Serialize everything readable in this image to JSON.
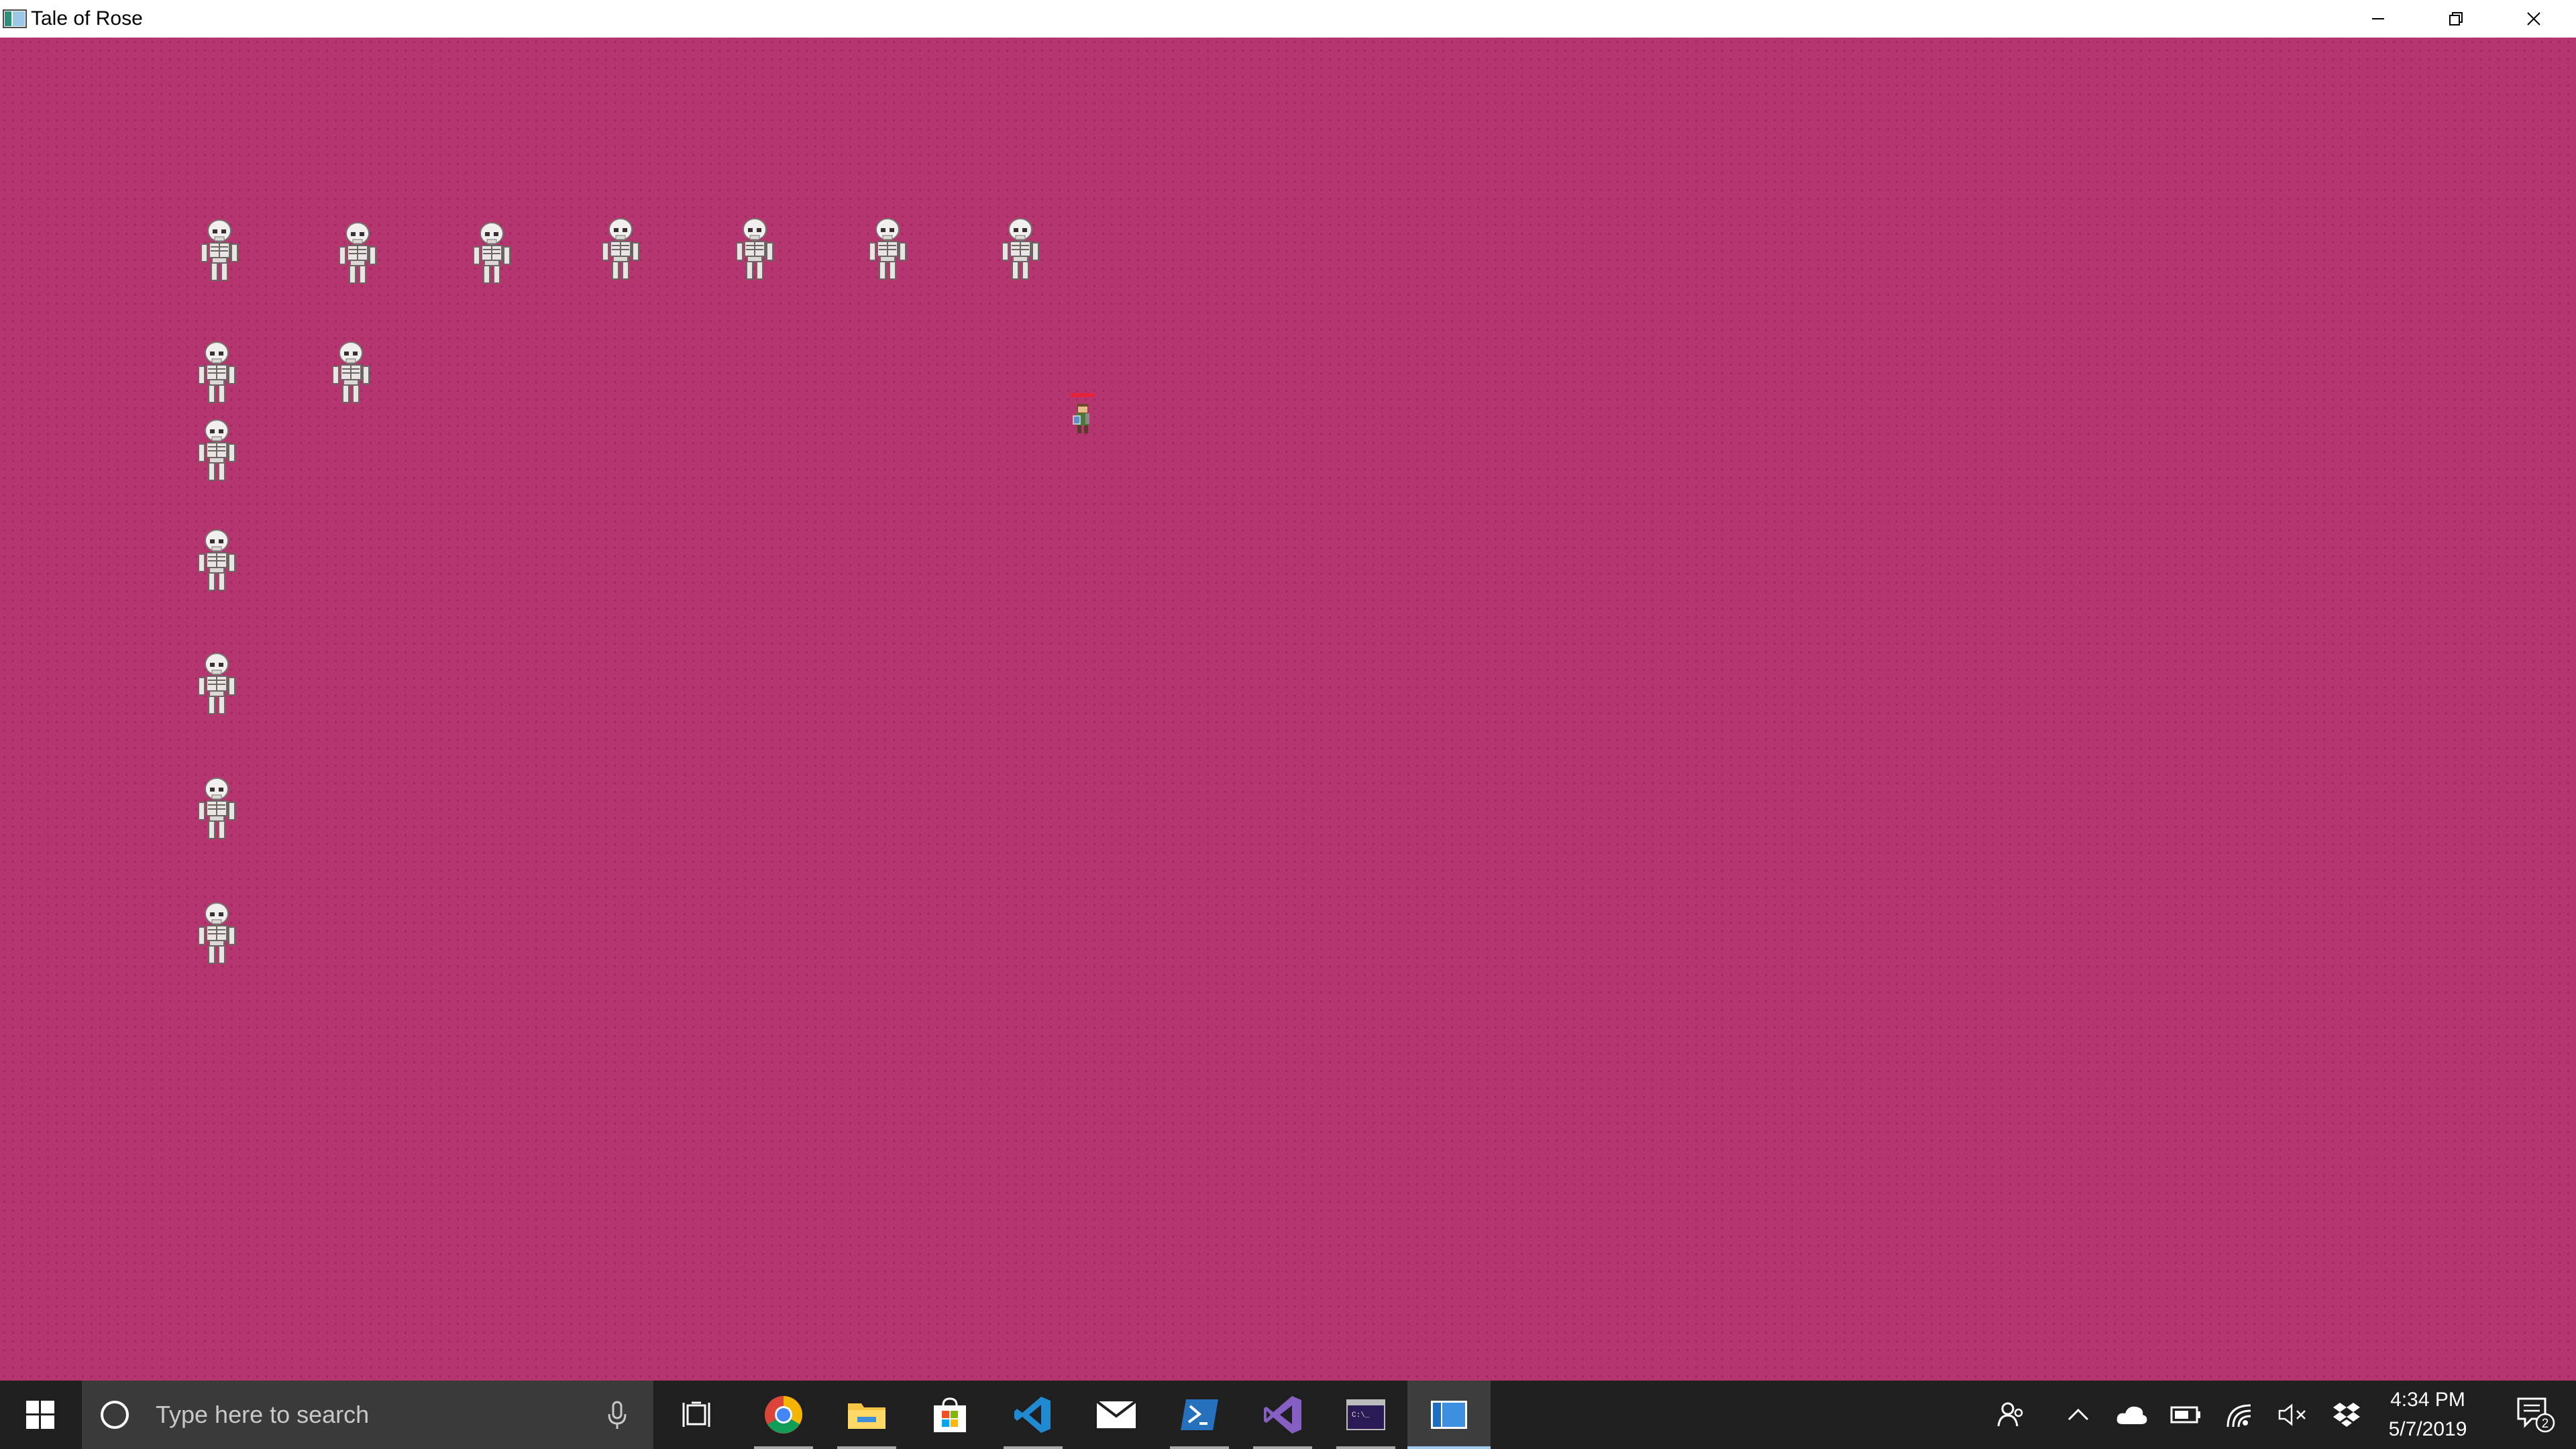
{
  "window": {
    "title": "Tale of Rose",
    "minimize_icon": "minimize-icon",
    "restore_icon": "restore-icon",
    "close_icon": "close-icon"
  },
  "game": {
    "background_color": "#b5356f",
    "enemy_type": "skeleton",
    "enemy_count": 15,
    "player_type": "hero-with-health-bar",
    "health_bar_color": "#e8213a"
  },
  "taskbar": {
    "search_placeholder": "Type here to search",
    "pinned_apps": [
      {
        "name": "task-view",
        "icon": "task-view-icon"
      },
      {
        "name": "chrome",
        "icon": "chrome-icon"
      },
      {
        "name": "file-explorer",
        "icon": "folder-icon"
      },
      {
        "name": "microsoft-store",
        "icon": "store-bag-icon"
      },
      {
        "name": "vs-code",
        "icon": "vscode-icon"
      },
      {
        "name": "mail",
        "icon": "mail-icon"
      },
      {
        "name": "powershell",
        "icon": "powershell-icon"
      },
      {
        "name": "visual-studio",
        "icon": "visual-studio-icon"
      },
      {
        "name": "command-prompt",
        "icon": "terminal-icon"
      },
      {
        "name": "tale-of-rose",
        "icon": "game-window-icon"
      }
    ],
    "tray_icons": [
      "people-icon",
      "chevron-up-icon",
      "onedrive-icon",
      "battery-icon",
      "wifi-icon",
      "volume-muted-icon",
      "dropbox-icon"
    ],
    "time": "4:34 PM",
    "date": "5/7/2019",
    "notification_count": "2"
  }
}
